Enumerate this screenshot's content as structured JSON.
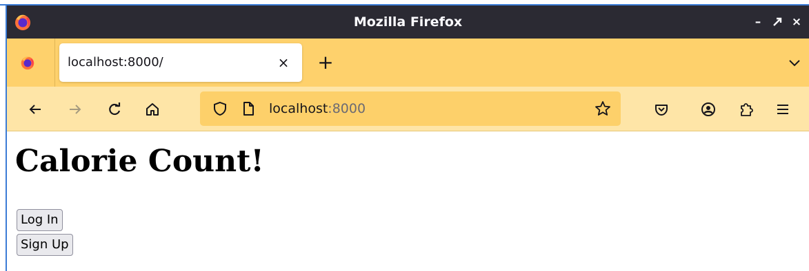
{
  "window": {
    "title": "Mozilla Firefox",
    "minimize_label": "–",
    "maximize_label": "↗",
    "close_label": "×"
  },
  "tabs": [
    {
      "label": "localhost:8000/",
      "close_label": "×",
      "active": true
    }
  ],
  "new_tab_label": "+",
  "urlbar": {
    "host": "localhost",
    "port": ":8000"
  },
  "page": {
    "heading": "Calorie Count!",
    "buttons": [
      {
        "label": "Log In"
      },
      {
        "label": "Sign Up"
      }
    ]
  },
  "colors": {
    "titlebar": "#2b2a33",
    "tabstrip": "#fed16c",
    "navbar": "#fee5a7",
    "urlbar": "#fdd06a",
    "frame_accent": "#3a7bd5"
  },
  "icons": {
    "back": "arrow-left-icon",
    "forward": "arrow-right-icon",
    "reload": "reload-icon",
    "home": "home-icon",
    "tracking": "shield-icon",
    "page": "page-icon",
    "bookmark": "star-icon",
    "pocket": "pocket-icon",
    "account": "account-icon",
    "extensions": "puzzle-icon",
    "menu": "hamburger-menu-icon"
  }
}
